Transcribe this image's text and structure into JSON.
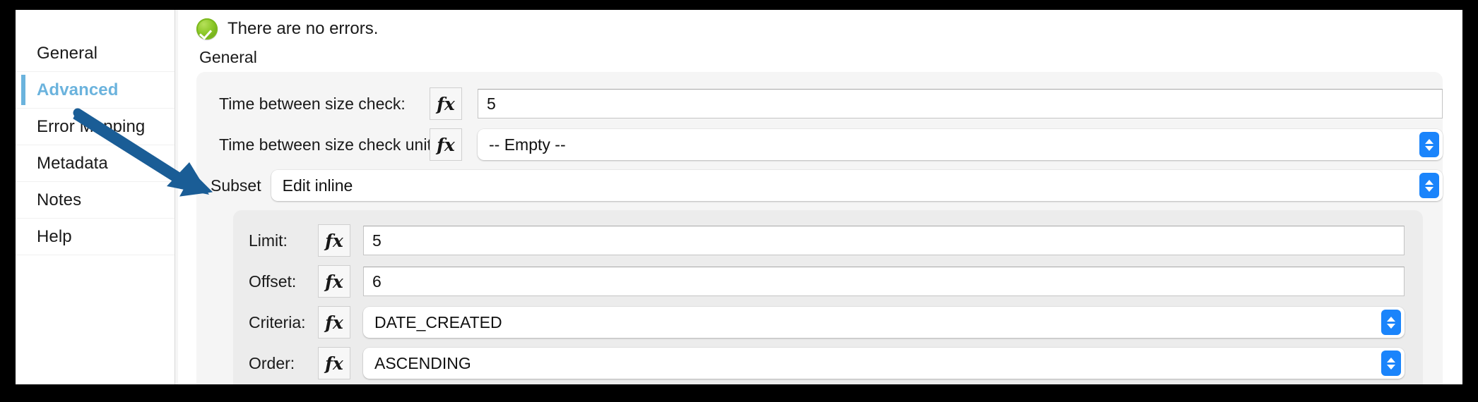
{
  "sidebar": {
    "items": [
      {
        "label": "General",
        "active": false
      },
      {
        "label": "Advanced",
        "active": true
      },
      {
        "label": "Error Mapping",
        "active": false
      },
      {
        "label": "Metadata",
        "active": false
      },
      {
        "label": "Notes",
        "active": false
      },
      {
        "label": "Help",
        "active": false
      }
    ]
  },
  "status": {
    "icon": "success-check-icon",
    "text": "There are no errors."
  },
  "main": {
    "group_label": "General",
    "fx_label": "fx",
    "fields": [
      {
        "label": "Time between size check:",
        "value": "5",
        "control": "text"
      },
      {
        "label": "Time between size check unit:",
        "value": "-- Empty --",
        "control": "popup"
      }
    ],
    "subset": {
      "label": "Subset",
      "value": "Edit inline",
      "control": "popup"
    },
    "subset_fields": [
      {
        "label": "Limit:",
        "value": "5",
        "control": "text"
      },
      {
        "label": "Offset:",
        "value": "6",
        "control": "text"
      },
      {
        "label": "Criteria:",
        "value": "DATE_CREATED",
        "control": "popup"
      },
      {
        "label": "Order:",
        "value": "ASCENDING",
        "control": "popup"
      }
    ]
  },
  "annotation": {
    "type": "arrow",
    "color": "#1a5d96",
    "points_to": "subset-row"
  },
  "colors": {
    "accent": "#6bb3dd",
    "stepper_blue": "#1a84fb",
    "success_green": "#8cc828",
    "arrow_blue": "#1a5d96",
    "panel_bg": "#f5f5f5",
    "subpanel_bg": "#ececec"
  }
}
